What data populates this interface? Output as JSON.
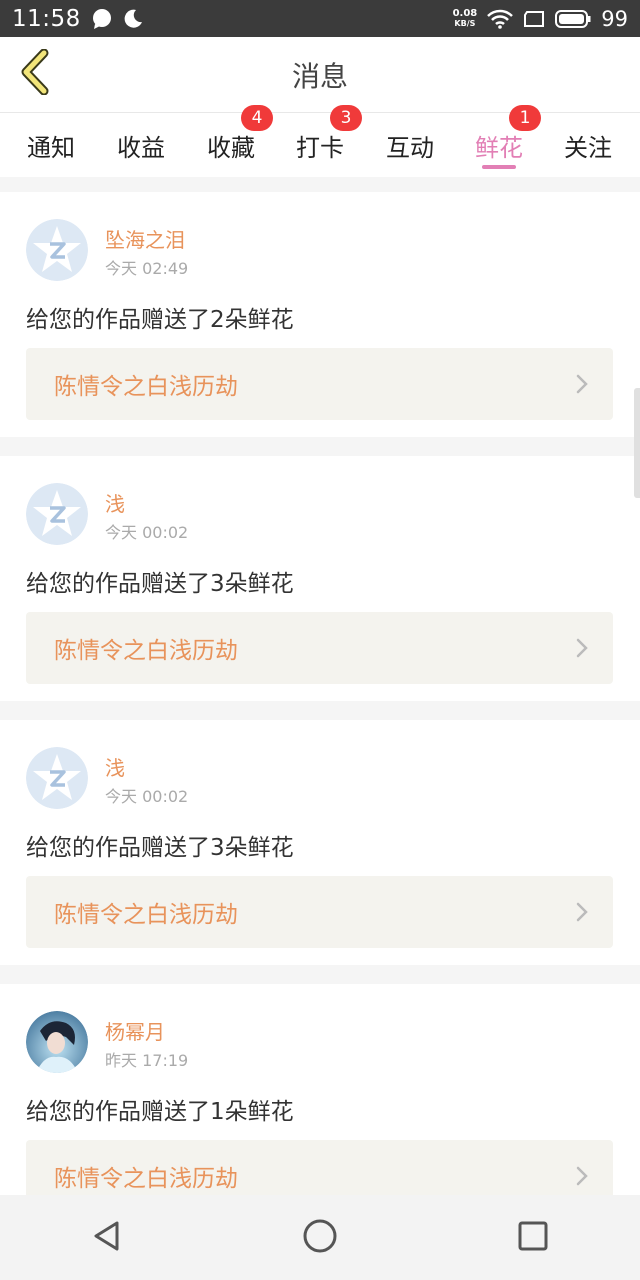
{
  "status_bar": {
    "time": "11:58",
    "net_speed_value": "0.08",
    "net_speed_unit": "KB/S",
    "battery_level": "99",
    "icons": [
      "chat-bubble-icon",
      "moon-icon",
      "wifi-icon",
      "screen-icon",
      "battery-icon"
    ]
  },
  "header": {
    "title": "消息",
    "back_icon": "chevron-left-icon"
  },
  "tabs": [
    {
      "label": "通知",
      "badge": ""
    },
    {
      "label": "收益",
      "badge": ""
    },
    {
      "label": "收藏",
      "badge": "4"
    },
    {
      "label": "打卡",
      "badge": "3"
    },
    {
      "label": "互动",
      "badge": ""
    },
    {
      "label": "鲜花",
      "badge": "1",
      "active": true
    },
    {
      "label": "关注",
      "badge": ""
    }
  ],
  "messages": [
    {
      "user": "坠海之泪",
      "time": "今天 02:49",
      "text": "给您的作品赠送了2朵鲜花",
      "work": "陈情令之白浅历劫",
      "avatar": "default"
    },
    {
      "user": "浅",
      "time": "今天 00:02",
      "text": "给您的作品赠送了3朵鲜花",
      "work": "陈情令之白浅历劫",
      "avatar": "default"
    },
    {
      "user": "浅",
      "time": "今天 00:02",
      "text": "给您的作品赠送了3朵鲜花",
      "work": "陈情令之白浅历劫",
      "avatar": "default"
    },
    {
      "user": "杨幂月",
      "time": "昨天 17:19",
      "text": "给您的作品赠送了1朵鲜花",
      "work": "陈情令之白浅历劫",
      "avatar": "photo"
    }
  ],
  "colors": {
    "accent": "#e27fb5",
    "username": "#e8935b",
    "badge": "#f03a3a",
    "link_bg": "#f4f3ee",
    "status_bar": "#3b3b3b"
  },
  "nav": [
    "back-triangle-icon",
    "home-circle-icon",
    "recents-square-icon"
  ]
}
